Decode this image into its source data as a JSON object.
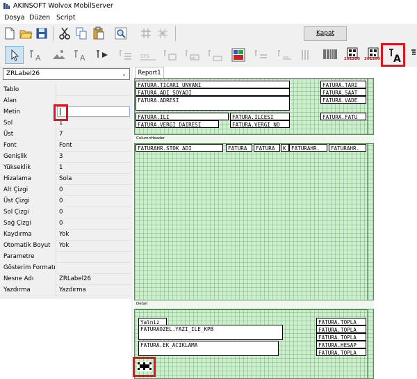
{
  "window": {
    "title": "AKINSOFT Wolvox MobilServer"
  },
  "menu": {
    "items": [
      "Dosya",
      "Düzen",
      "Script"
    ]
  },
  "toolbar": {
    "close_label": "Kapat"
  },
  "toolbar2": {
    "badge_left": "201200",
    "badge_right": "201200"
  },
  "object_selector": {
    "value": "ZRLabel26"
  },
  "properties": [
    {
      "name": "Tablo",
      "value": ""
    },
    {
      "name": "Alan",
      "value": ""
    },
    {
      "name": "Metin",
      "value": ""
    },
    {
      "name": "Sol",
      "value": "1"
    },
    {
      "name": "Üst",
      "value": "7"
    },
    {
      "name": "Font",
      "value": "Font"
    },
    {
      "name": "Genişlik",
      "value": "3"
    },
    {
      "name": "Yükseklik",
      "value": "1"
    },
    {
      "name": "Hizalama",
      "value": "Sola"
    },
    {
      "name": "Alt Çizgi",
      "value": "0"
    },
    {
      "name": "Üst Çizgi",
      "value": "0"
    },
    {
      "name": "Sol Çizgi",
      "value": "0"
    },
    {
      "name": "Sağ Çizgi",
      "value": "0"
    },
    {
      "name": "Kaydırma",
      "value": "Yok"
    },
    {
      "name": "Otomatik Boyut",
      "value": "Yok"
    },
    {
      "name": "Parametre",
      "value": ""
    },
    {
      "name": "Gösterim Formatı",
      "value": ""
    },
    {
      "name": "Nesne Adı",
      "value": "ZRLabel26"
    },
    {
      "name": "Yazdırma",
      "value": "Yazdırma"
    }
  ],
  "report": {
    "tab": "Report1",
    "band_column_header": "ColumnHeader",
    "band_detail": "Detail",
    "header_fields": [
      "FATURA.TICARI_UNVANI",
      "FATURA.ADI_SOYADI",
      "FATURA.ADRESI",
      "FATURA.ILI",
      "FATURA.ILCESI",
      "FATURA.VERGI_DAIRESI",
      "FATURA.VERGI_NO",
      "FATURA.TARI",
      "FATURA.SAAT",
      "FATURA.VADE",
      "FATURA.FATU"
    ],
    "column_fields": [
      "FATURAHR.STOK_ADI",
      "FATURA",
      "FATURA",
      "K",
      "FATURAHR.",
      "FATURAHR."
    ],
    "footer_fields": [
      "Yalniz",
      "FATURAOZEL.YAZI_ILE_KPB",
      "FATURA.EK_ACIKLAMA",
      "FATURA.TOPLA",
      "FATURA.TOPLA",
      "FATURA.TOPLA",
      "FATURA.HESAP",
      "FATURA.TOPLA"
    ]
  }
}
